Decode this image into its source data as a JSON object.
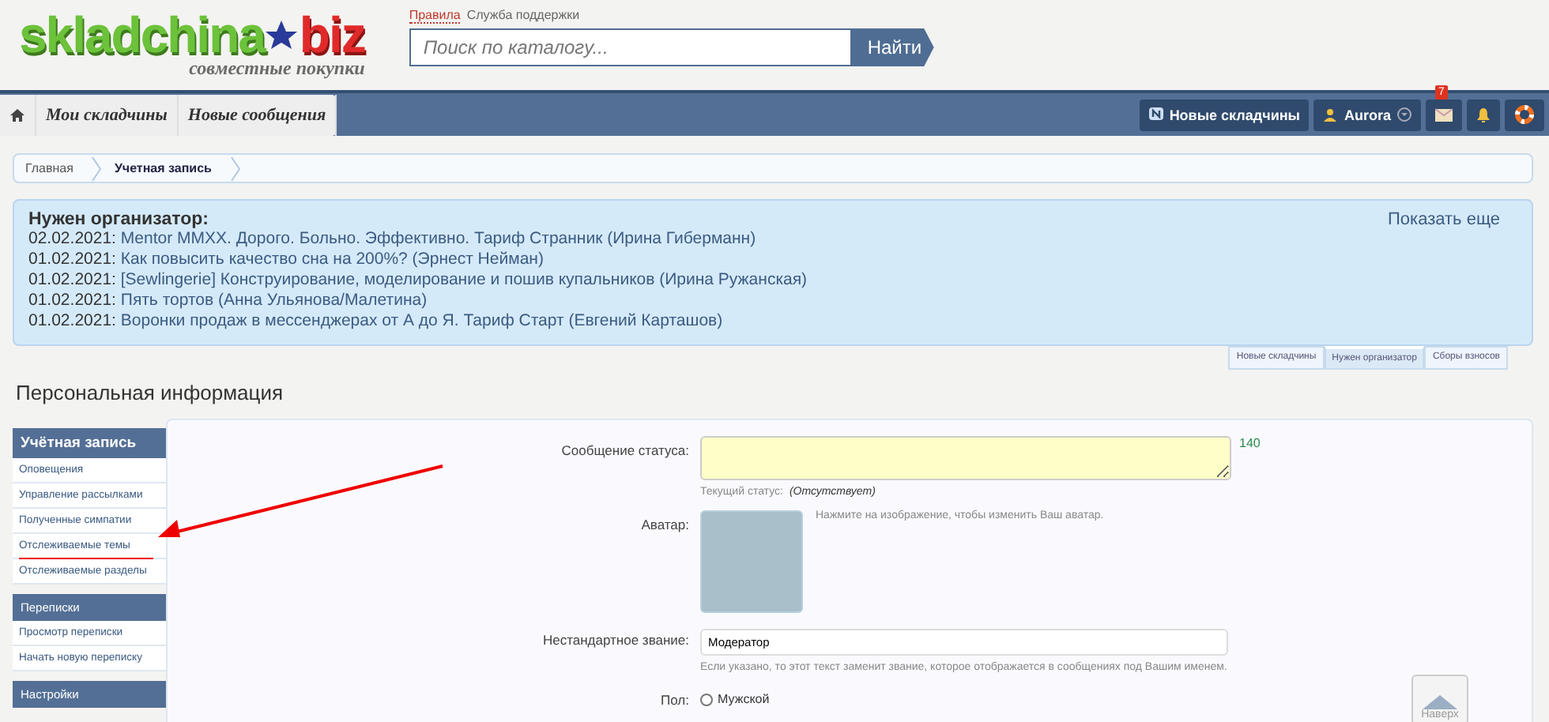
{
  "header": {
    "logo": {
      "name_left": "skladchina",
      "name_right": "biz",
      "tagline": "совместные покупки"
    },
    "top_links": [
      {
        "label": "Правила",
        "highlighted": true
      },
      {
        "label": "Служба поддержки",
        "highlighted": false
      }
    ],
    "search": {
      "placeholder": "Поиск по каталогу...",
      "button": "Найти"
    }
  },
  "navbar": {
    "tabs": [
      {
        "label": "Мои складчины"
      },
      {
        "label": "Новые сообщения"
      }
    ],
    "new_button": "Новые складчины",
    "user": "Aurora",
    "inbox_badge": "7"
  },
  "breadcrumb": [
    "Главная",
    "Учетная запись"
  ],
  "notice": {
    "title": "Нужен организатор:",
    "more": "Показать еще",
    "items": [
      {
        "date": "02.02.2021:",
        "text": "Mentor MMXX. Дорого. Больно. Эффективно. Тариф Странник (Ирина Гиберманн)"
      },
      {
        "date": "01.02.2021:",
        "text": "Как повысить качество сна на 200%? (Эрнест Нейман)"
      },
      {
        "date": "01.02.2021:",
        "text": "[Sewlingerie] Конструирование, моделирование и пошив купальников (Ирина Ружанская)"
      },
      {
        "date": "01.02.2021:",
        "text": "Пять тортов (Анна Ульянова/Малетина)"
      },
      {
        "date": "01.02.2021:",
        "text": "Воронки продаж в мессенджерах от А до Я. Тариф Старт (Евгений Карташов)"
      }
    ],
    "tabs": [
      {
        "label": "Новые складчины",
        "selected": false
      },
      {
        "label": "Нужен организатор",
        "selected": true
      },
      {
        "label": "Сборы взносов",
        "selected": false
      }
    ]
  },
  "page_title": "Персональная информация",
  "sidebar": [
    {
      "title": "Учётная запись",
      "items": [
        {
          "label": "Оповещения",
          "marked": false
        },
        {
          "label": "Управление рассылками",
          "marked": false
        },
        {
          "label": "Полученные симпатии",
          "marked": false
        },
        {
          "label": "Отслеживаемые темы",
          "marked": true
        },
        {
          "label": "Отслеживаемые разделы",
          "marked": false
        }
      ]
    },
    {
      "title": "Переписки",
      "items": [
        {
          "label": "Просмотр переписки",
          "marked": false
        },
        {
          "label": "Начать новую переписку",
          "marked": false
        }
      ]
    },
    {
      "title": "Настройки"
    }
  ],
  "form": {
    "status": {
      "label": "Сообщение статуса:",
      "counter": "140",
      "hint_label": "Текущий статус:",
      "hint_value": "(Отсутствует)"
    },
    "avatar": {
      "label": "Аватар:",
      "hint": "Нажмите на изображение, чтобы изменить Ваш аватар."
    },
    "custom_title": {
      "label": "Нестандартное звание:",
      "value": "Модератор",
      "hint": "Если указано, то этот текст заменит звание, которое отображается в сообщениях под Вашим именем."
    },
    "gender": {
      "label": "Пол:",
      "options": [
        {
          "label": "Мужской",
          "checked": false
        }
      ]
    }
  },
  "scroll_top": "Наверх"
}
